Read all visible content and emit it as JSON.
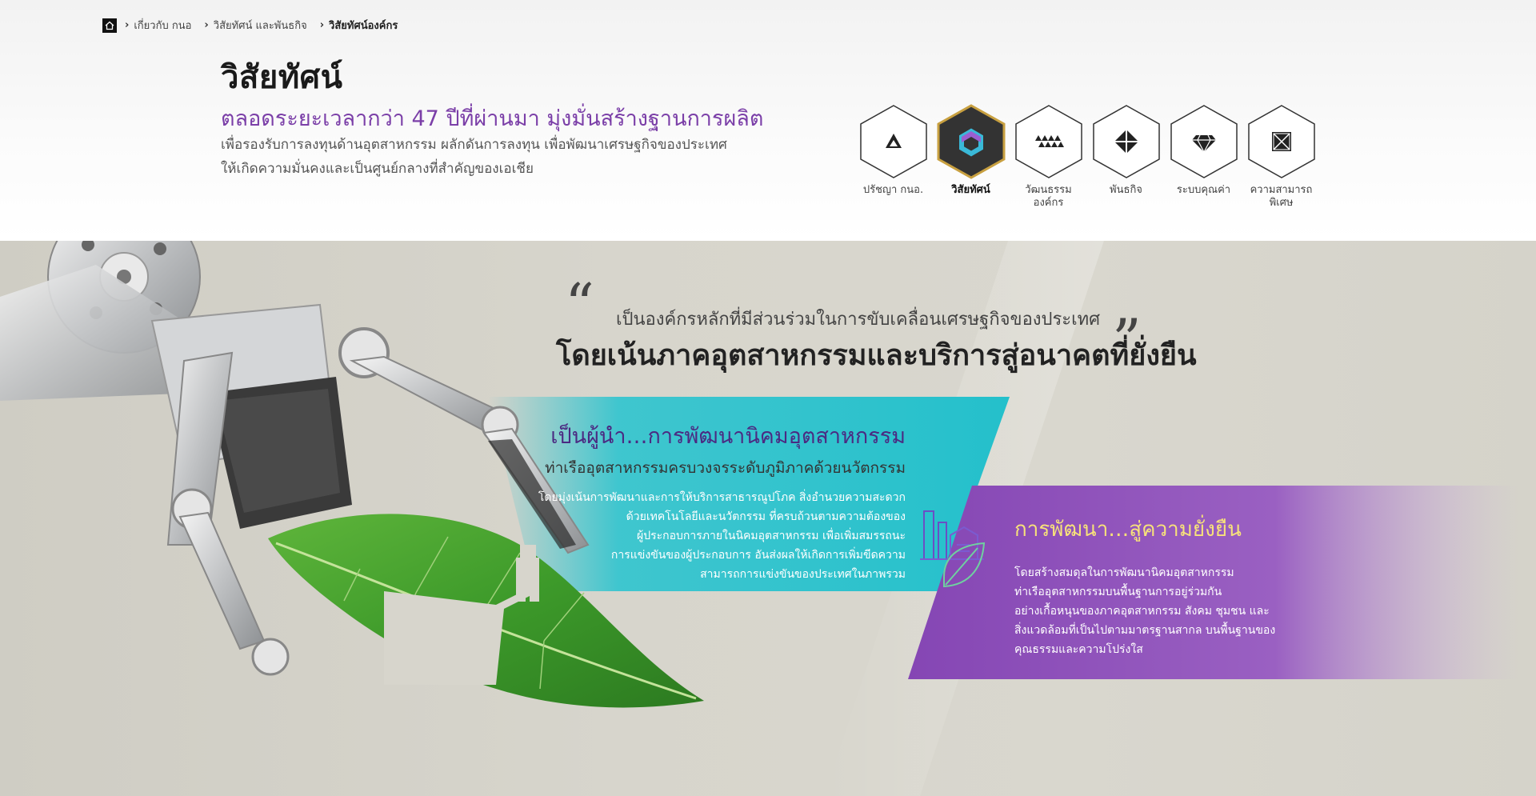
{
  "breadcrumb": {
    "items": [
      "เกี่ยวกับ กนอ",
      "วิสัยทัศน์ และพันธกิจ",
      "วิสัยทัศน์องค์กร"
    ]
  },
  "header": {
    "title": "วิสัยทัศน์",
    "subtitle": "ตลอดระยะเวลากว่า 47 ปีที่ผ่านมา มุ่งมั่นสร้างฐานการผลิต",
    "desc_line1": "เพื่อรองรับการลงทุนด้านอุตสาหกรรม ผลักดันการลงทุน เพื่อพัฒนาเศรษฐกิจของประเทศ",
    "desc_line2": "ให้เกิดความมั่นคงและเป็นศูนย์กลางที่สำคัญของเอเชีย"
  },
  "nav": {
    "items": [
      {
        "label": "ปรัชญา กนอ.",
        "icon": "triangle-icon",
        "active": false
      },
      {
        "label": "วิสัยทัศน์",
        "icon": "vision-ring-icon",
        "active": true
      },
      {
        "label": "วัฒนธรรมองค์กร",
        "icon": "triangles-culture-icon",
        "active": false
      },
      {
        "label": "พันธกิจ",
        "icon": "diamond-mission-icon",
        "active": false
      },
      {
        "label": "ระบบคุณค่า",
        "icon": "gem-icon",
        "active": false
      },
      {
        "label": "ความสามารถ พิเศษ",
        "icon": "crossed-square-icon",
        "active": false
      }
    ]
  },
  "quote": {
    "open": "“",
    "close": "”",
    "small": "เป็นองค์กรหลักที่มีส่วนร่วมในการขับเคลื่อนเศรษฐกิจของประเทศ",
    "big": "โดยเน้นภาคอุตสาหกรรมและบริการสู่อนาคตที่ยั่งยืน"
  },
  "teal_panel": {
    "title": "เป็นผู้นำ…การพัฒนานิคมอุตสาหกรรม",
    "subtitle": "ท่าเรืออุตสาหกรรมครบวงจรระดับภูมิภาคด้วยนวัตกรรม",
    "body": [
      "โดยมุ่งเน้นการพัฒนาและการให้บริการสาธารณูปโภค สิ่งอำนวยความสะดวก",
      "ด้วยเทคโนโลยีและนวัตกรรม ที่ครบถ้วนตามความต้องของ",
      "ผู้ประกอบการภายในนิคมอุตสาหกรรม เพื่อเพิ่มสมรรถนะ",
      "การแข่งขันของผู้ประกอบการ อันส่งผลให้เกิดการเพิ่มขีดความ",
      "สามารถการแข่งขันของประเทศในภาพรวม"
    ]
  },
  "purple_panel": {
    "title": "การพัฒนา…สู่ความยั่งยืน",
    "body": [
      "โดยสร้างสมดุลในการพัฒนานิคมอุตสาหกรรม",
      "ท่าเรืออุตสาหกรรมบนพื้นฐานการอยู่ร่วมกัน",
      "อย่างเกื้อหนุนของภาคอุตสาหกรรม สังคม ชุมชน และ",
      "สิ่งแวดล้อมที่เป็นไปตามมาตรฐานสากล บนพื้นฐานของ",
      "คุณธรรมและความโปร่งใส"
    ]
  },
  "colors": {
    "accent_purple": "#7b3fa8",
    "teal": "#2ec4cf",
    "purple_panel": "#8a4fb6",
    "yellow_title": "#f7e27a",
    "active_hex_border": "#c8a040"
  }
}
